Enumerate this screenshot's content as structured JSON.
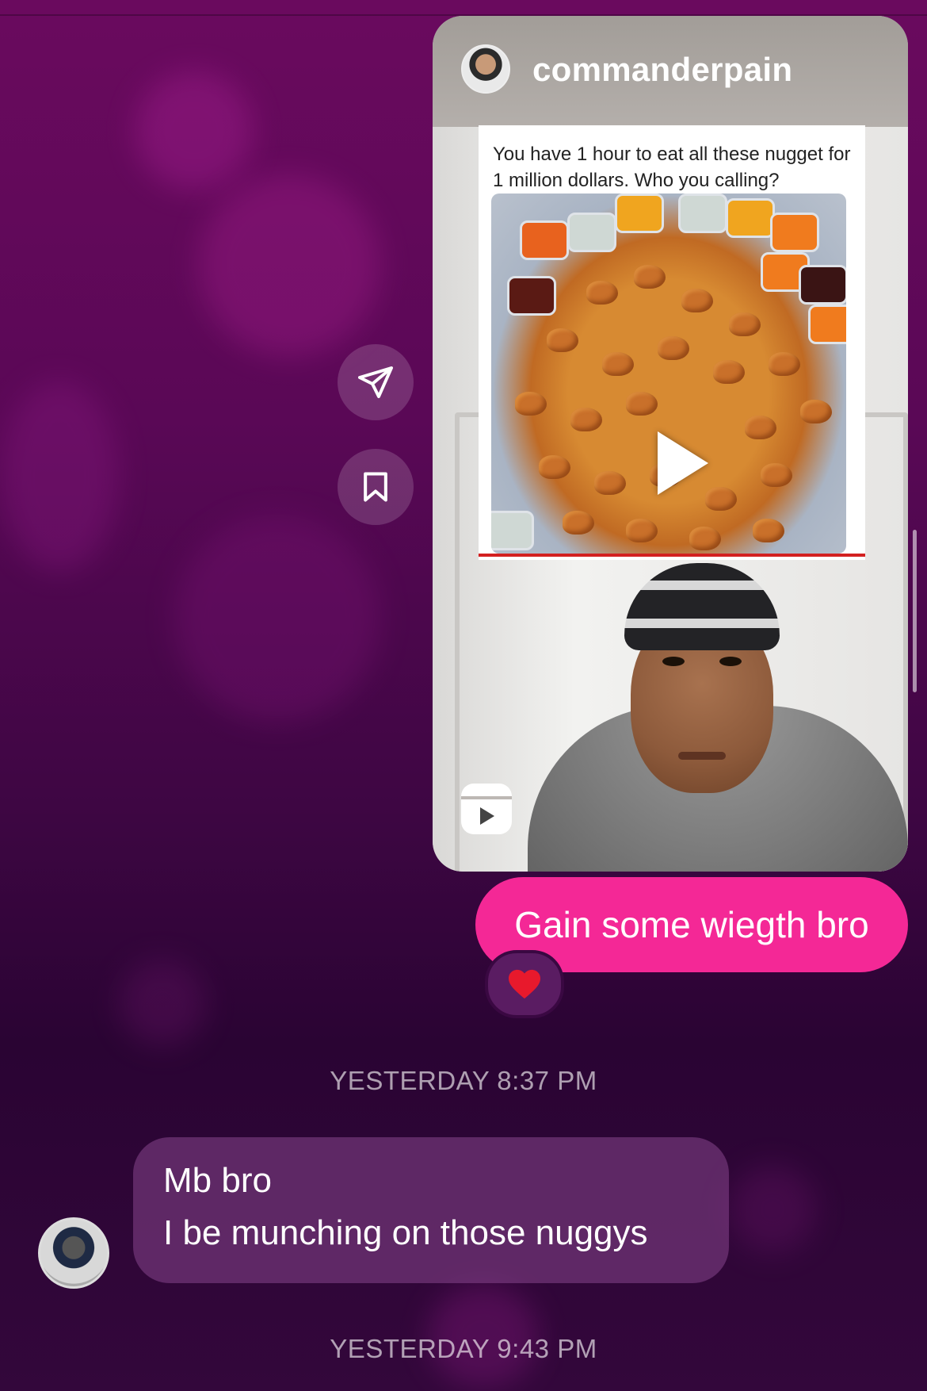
{
  "shared_reel": {
    "username": "commanderpain",
    "caption": "You have 1 hour to eat all these nugget for 1 million dollars. Who you calling?"
  },
  "side_actions": {
    "share_icon": "paper-plane-icon",
    "save_icon": "bookmark-icon"
  },
  "sent_message": {
    "text": "Gain some wiegth bro",
    "reaction": "❤️"
  },
  "timestamps": {
    "first": "YESTERDAY 8:37 PM",
    "second": "YESTERDAY 9:43 PM"
  },
  "received_message": {
    "line1": "Mb bro",
    "line2": "I be munching on those nuggys"
  },
  "colors": {
    "sent_bubble": "#f42896",
    "received_bubble": "#87468c",
    "background_top": "#6a0a5e",
    "background_bottom": "#2a0433"
  }
}
